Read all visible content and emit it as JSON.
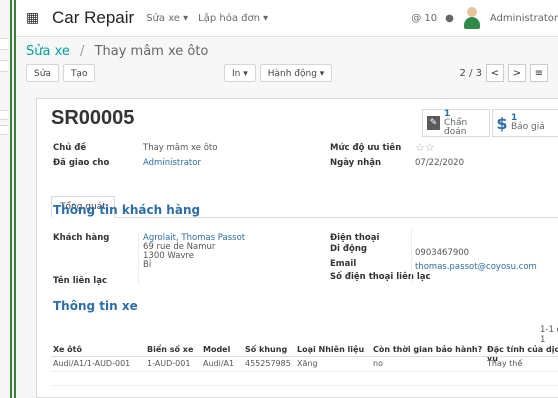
{
  "topbar": {
    "brand": "Car Repair",
    "menu_repair": "Sửa xe ▾",
    "menu_invoice": "Lập hóa đơn ▾",
    "notif_count": "@ 10",
    "chat_icon": "chat-icon",
    "user": "Administrator"
  },
  "breadcrumb": {
    "root": "Sửa xe",
    "sep": "/",
    "current": "Thay mâm xe ôto"
  },
  "actions": {
    "edit": "Sửa",
    "create": "Tạo",
    "print": "In ▾",
    "action": "Hành động ▾"
  },
  "pager": {
    "value": "2 / 3",
    "prev": "<",
    "next": ">",
    "list_view": "≡"
  },
  "record": {
    "ref": "SR00005",
    "smart_buttons": [
      {
        "icon": "diagnosis-icon",
        "count": "1",
        "label": "Chẩn đoán"
      },
      {
        "icon": "dollar-icon",
        "count": "1",
        "label": "Báo giá"
      }
    ],
    "subject_label": "Chủ đề",
    "subject_value": "Thay mâm xe ôto",
    "assigned_label": "Đã giao cho",
    "assigned_value": "Administrator",
    "priority_label": "Mức độ ưu tiên",
    "priority_stars": "☆☆",
    "received_label": "Ngày nhận",
    "received_value": "07/22/2020"
  },
  "tabs": [
    "Tổng quát"
  ],
  "customer": {
    "section": "Thông tin khách hàng",
    "customer_label": "Khách hàng",
    "customer_name": "Agrolait, Thomas Passot",
    "addr1": "69 rue de Namur",
    "addr2": "1300 Wavre",
    "addr3": "Bỉ",
    "contact_label": "Tên liên lạc",
    "phone_label": "Điện thoại",
    "mobile_label": "Di động",
    "mobile_value": "0903467900",
    "email_label": "Email",
    "email_value": "thomas.passot@coyosu.com",
    "contact_phone_label": "Số điện thoại liên lạc"
  },
  "vehicle": {
    "section": "Thông tin xe",
    "pager": "1-1 of 1",
    "columns": [
      "Xe ôtô",
      "Biển số xe",
      "Model",
      "Số khung",
      "Loại Nhiên liệu",
      "Còn thời gian bảo hành?",
      "Đặc tính của dịch vụ"
    ],
    "rows": [
      [
        "Audi/A1/1-AUD-001",
        "1-AUD-001",
        "Audi/A1",
        "455257985",
        "Xăng",
        "no",
        "Thay thế"
      ]
    ]
  }
}
